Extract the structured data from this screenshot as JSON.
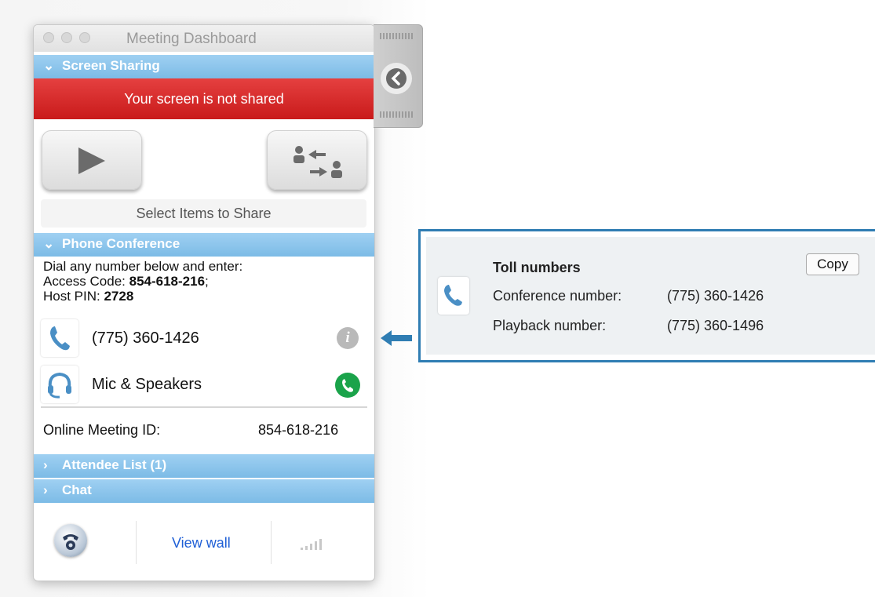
{
  "window": {
    "title": "Meeting Dashboard"
  },
  "screen_sharing": {
    "header": "Screen Sharing",
    "status": "Your screen is not shared",
    "select_items": "Select Items to Share"
  },
  "phone_conference": {
    "header": "Phone Conference",
    "instruction": "Dial any number below and enter:",
    "access_code_label": "Access Code: ",
    "access_code": "854-618-216",
    "host_pin_label": "Host PIN: ",
    "host_pin": "2728",
    "phone_number": "(775) 360-1426",
    "audio_label": "Mic & Speakers"
  },
  "meeting": {
    "id_label": "Online Meeting ID:",
    "id_value": "854-618-216"
  },
  "sections": {
    "attendee_list": "Attendee List (1)",
    "chat": "Chat"
  },
  "footer": {
    "view_wall": "View wall"
  },
  "toll_panel": {
    "title": "Toll numbers",
    "copy_label": "Copy",
    "conference_label": "Conference number:",
    "conference_value": "(775) 360-1426",
    "playback_label": "Playback number:",
    "playback_value": "(775) 360-1496"
  },
  "colors": {
    "section_blue": "#7cbbe6",
    "alert_red": "#d42b2b",
    "call_green": "#1aa34a",
    "link_blue": "#1f5fd6",
    "callout_blue": "#2f7db3"
  }
}
